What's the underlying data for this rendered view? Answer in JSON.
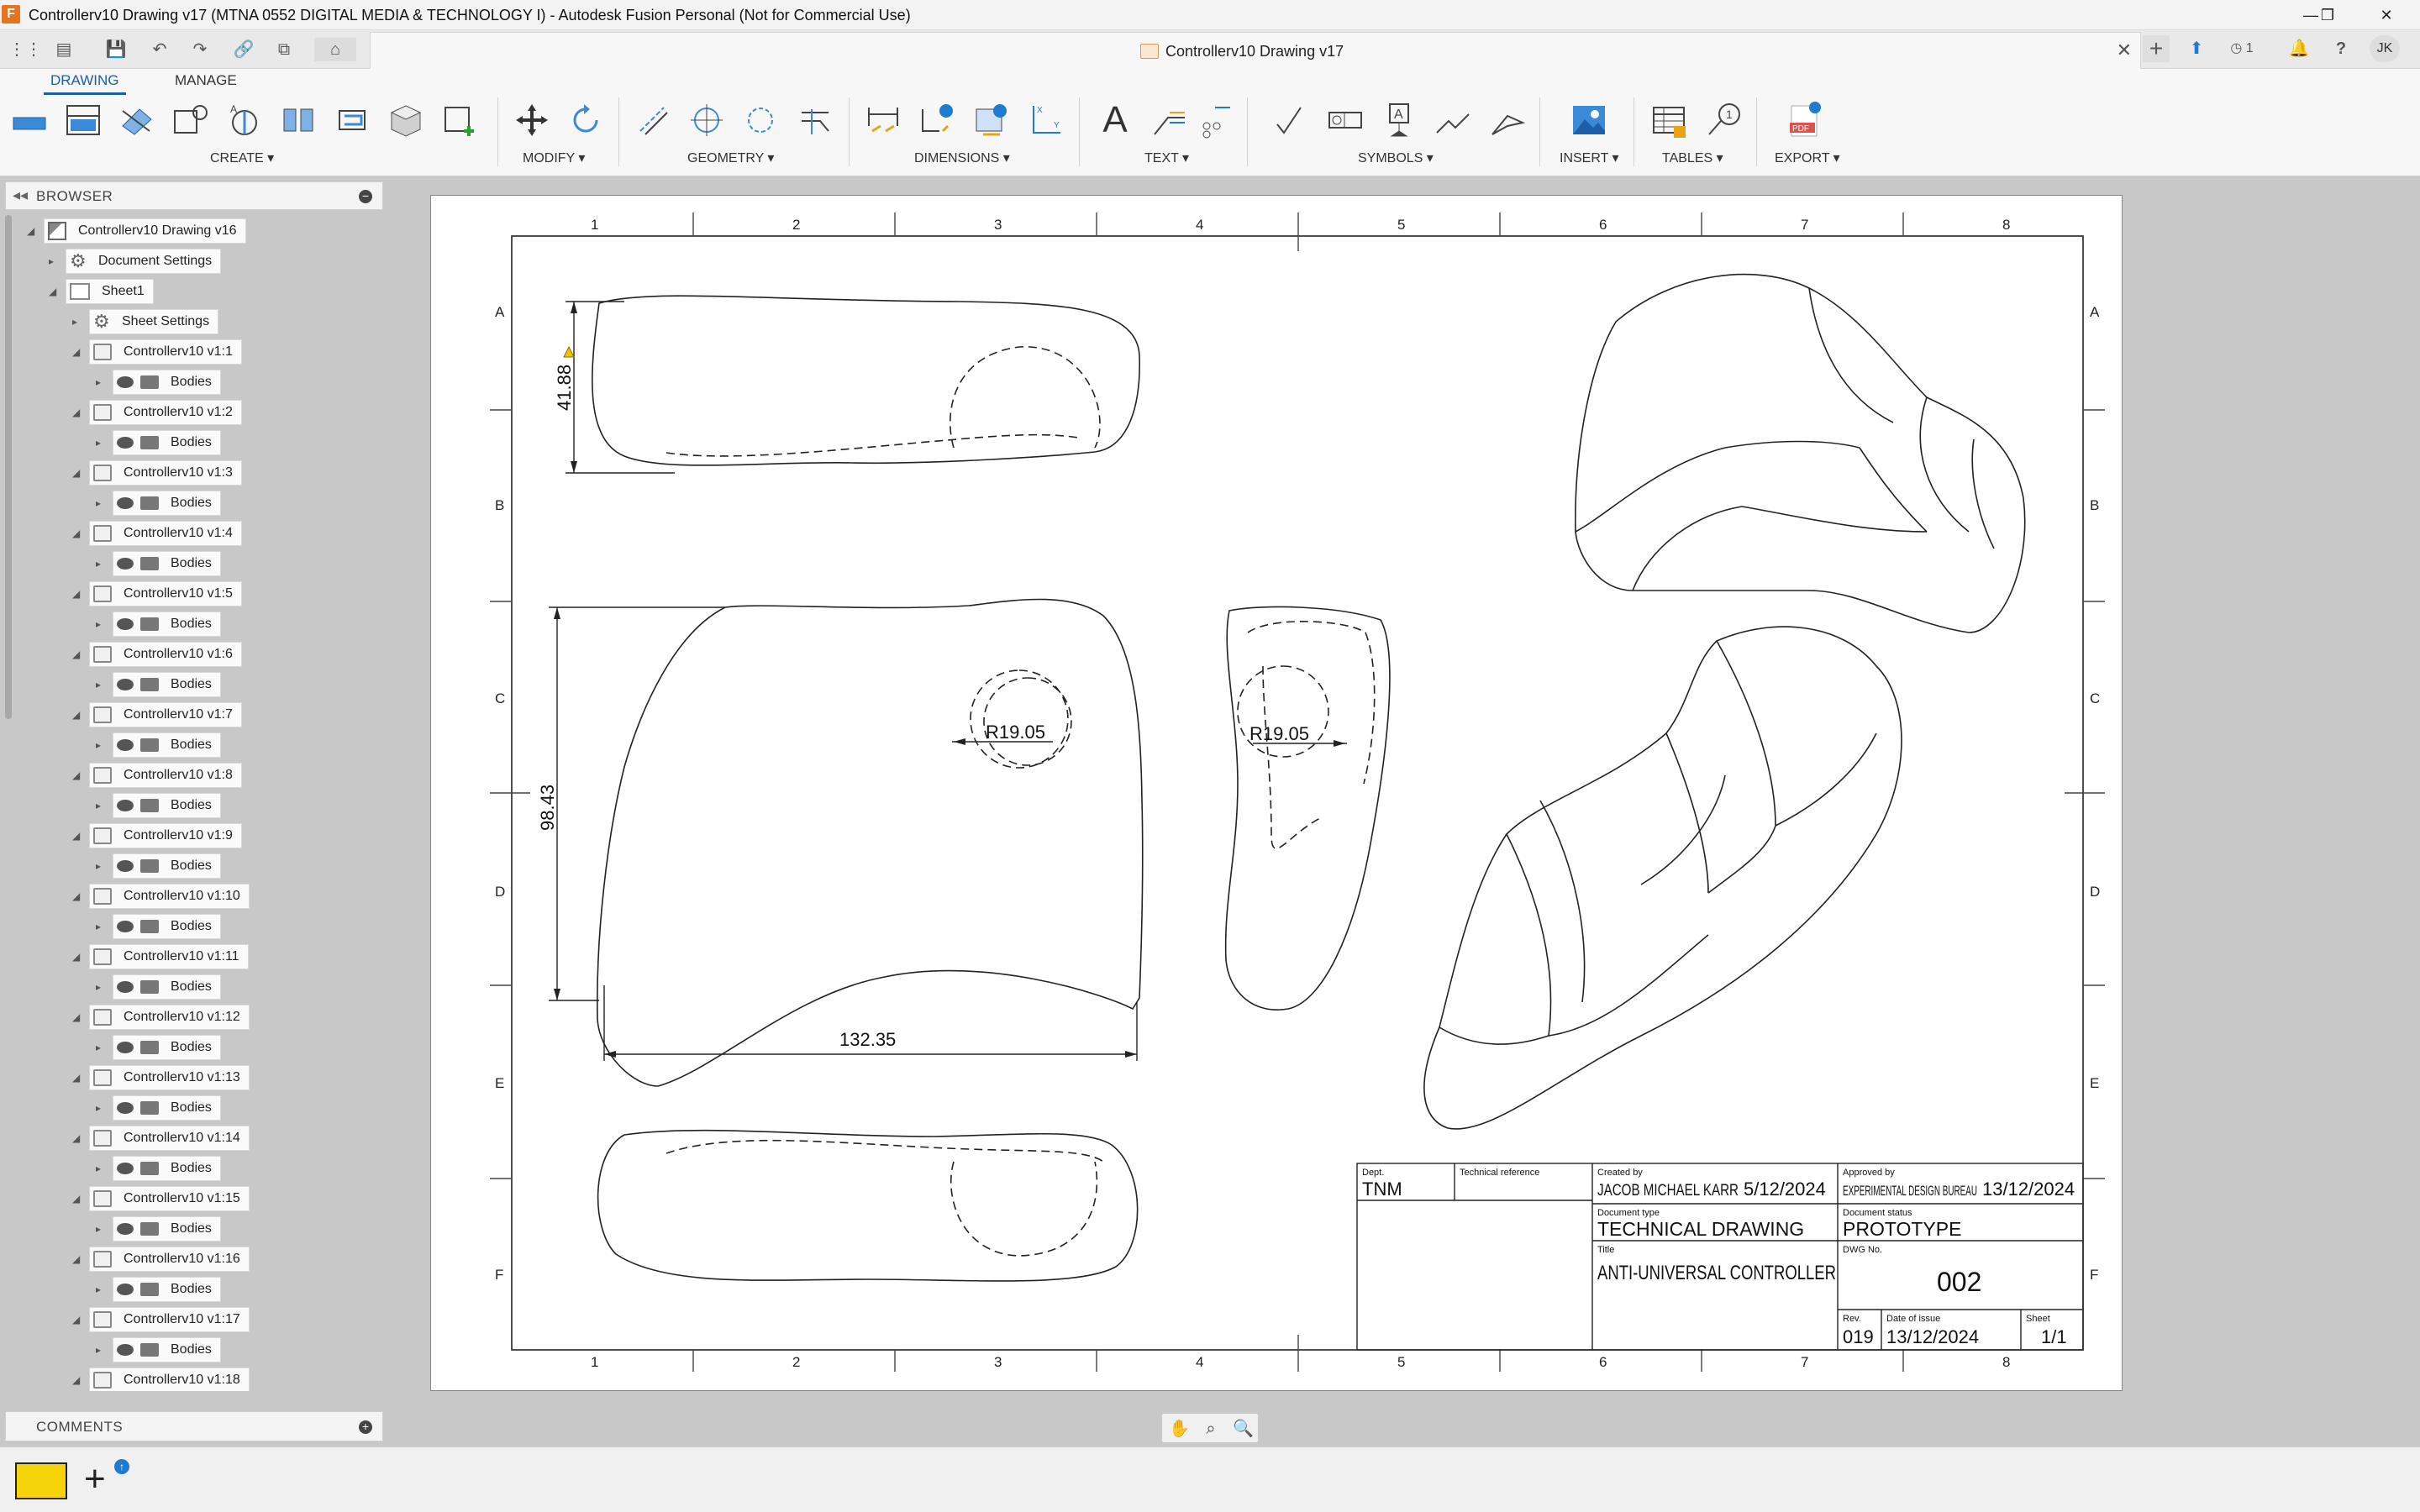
{
  "window": {
    "title": "Controllerv10 Drawing v17 (MTNA 0552 DIGITAL MEDIA & TECHNOLOGY I) - Autodesk Fusion Personal (Not for Commercial Use)",
    "app_icon": "F",
    "minimize": "—",
    "maximize": "❐",
    "close": "✕"
  },
  "document_tab": {
    "title": "Controllerv10 Drawing v17",
    "close": "✕"
  },
  "quick_access": {
    "grid": "⋮⋮",
    "file": "▤",
    "save": "💾",
    "undo": "↶",
    "redo": "↷",
    "link": "🔗",
    "copy": "⧉",
    "home": "⌂",
    "new_tab": "+",
    "jobs_count": "1",
    "notifications": "🔔",
    "help": "?",
    "user_initials": "JK"
  },
  "ribbon": {
    "tabs": [
      {
        "label": "DRAWING",
        "active": true
      },
      {
        "label": "MANAGE",
        "active": false
      }
    ],
    "groups": {
      "create": "CREATE ▾",
      "modify": "MODIFY ▾",
      "geometry": "GEOMETRY ▾",
      "dimensions": "DIMENSIONS ▾",
      "text": "TEXT ▾",
      "symbols": "SYMBOLS ▾",
      "insert": "INSERT ▾",
      "tables": "TABLES ▾",
      "export": "EXPORT ▾"
    },
    "text_tool": "A",
    "balloon_tool": "1",
    "pdf_tool": "PDF"
  },
  "browser": {
    "label": "BROWSER",
    "collapse": "◂◂",
    "minimize": "−",
    "root": "Controllerv10 Drawing v16",
    "document_settings": "Document Settings",
    "sheet": "Sheet1",
    "sheet_settings": "Sheet Settings",
    "bodies_label": "Bodies",
    "components": [
      "Controllerv10 v1:1",
      "Controllerv10 v1:2",
      "Controllerv10 v1:3",
      "Controllerv10 v1:4",
      "Controllerv10 v1:5",
      "Controllerv10 v1:6",
      "Controllerv10 v1:7",
      "Controllerv10 v1:8",
      "Controllerv10 v1:9",
      "Controllerv10 v1:10",
      "Controllerv10 v1:11",
      "Controllerv10 v1:12",
      "Controllerv10 v1:13",
      "Controllerv10 v1:14",
      "Controllerv10 v1:15",
      "Controllerv10 v1:16",
      "Controllerv10 v1:17",
      "Controllerv10 v1:18"
    ]
  },
  "comments": {
    "label": "COMMENTS",
    "add": "+"
  },
  "drawing": {
    "columns": [
      "1",
      "2",
      "3",
      "4",
      "5",
      "6",
      "7",
      "8"
    ],
    "rows": [
      "A",
      "B",
      "C",
      "D",
      "E",
      "F"
    ],
    "dimensions": {
      "top_height": "41.88",
      "front_height": "98.43",
      "front_width": "132.35",
      "radius_front": "R19.05",
      "radius_side": "R19.05"
    },
    "title_block": {
      "dept_label": "Dept.",
      "dept": "TNM",
      "tech_ref_label": "Technical reference",
      "created_by_label": "Created by",
      "created_by": "JACOB MICHAEL KARR",
      "created_date": "5/12/2024",
      "approved_by_label": "Approved by",
      "approved_by": "EXPERIMENTAL DESIGN BUREAU",
      "approved_date": "13/12/2024",
      "doc_type_label": "Document type",
      "doc_type": "TECHNICAL DRAWING",
      "doc_status_label": "Document status",
      "doc_status": "PROTOTYPE",
      "title_label": "Title",
      "title": "ANTI-UNIVERSAL CONTROLLER",
      "dwg_no_label": "DWG No.",
      "dwg_no": "002",
      "rev_label": "Rev.",
      "rev": "019",
      "date_of_issue_label": "Date of issue",
      "date_of_issue": "13/12/2024",
      "sheet_label": "Sheet",
      "sheet": "1/1"
    }
  },
  "navbar": {
    "pan": "✋",
    "zoom_window": "⌕",
    "zoom": "🔍"
  },
  "status": {
    "add_badge": "↑",
    "add": "+"
  }
}
